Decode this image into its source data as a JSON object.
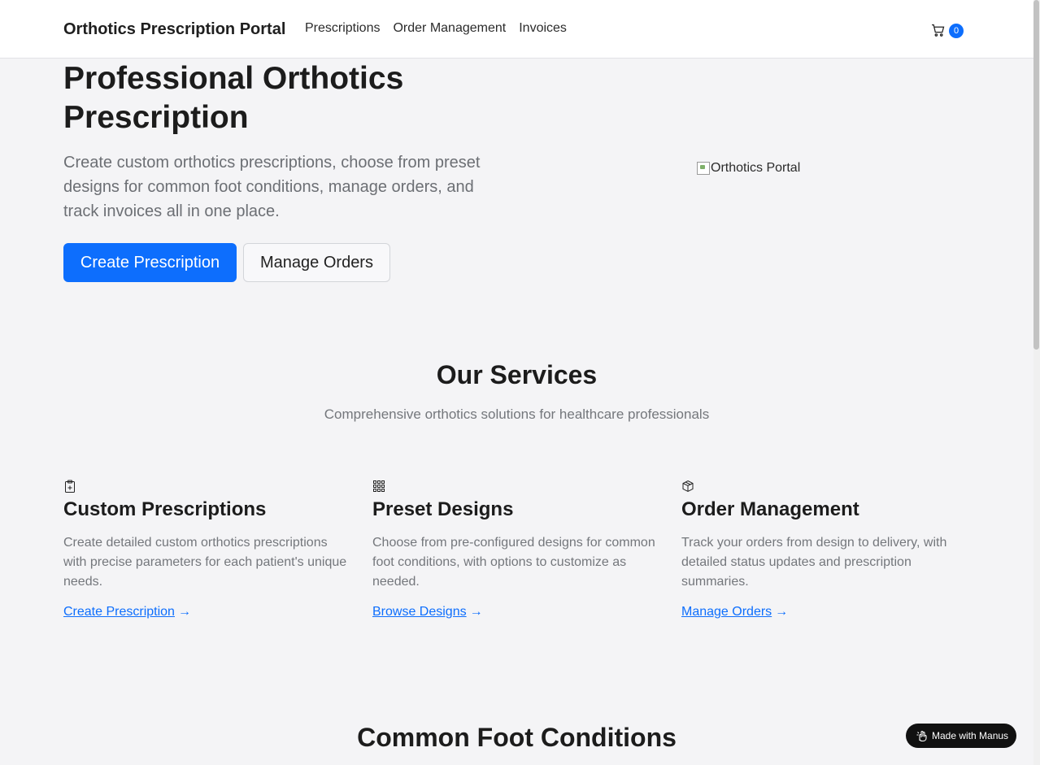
{
  "navbar": {
    "brand": "Orthotics Prescription Portal",
    "links": [
      "Prescriptions",
      "Order Management",
      "Invoices"
    ],
    "cart_count": "0"
  },
  "hero": {
    "title": "Professional Orthotics Prescription",
    "lead": "Create custom orthotics prescriptions, choose from preset designs for common foot conditions, manage orders, and track invoices all in one place.",
    "primary_button": "Create Prescription",
    "secondary_button": "Manage Orders",
    "image_alt": "Orthotics Portal"
  },
  "services": {
    "title": "Our Services",
    "subtitle": "Comprehensive orthotics solutions for healthcare professionals",
    "cards": [
      {
        "icon": "clipboard-plus-icon",
        "title": "Custom Prescriptions",
        "text": "Create detailed custom orthotics prescriptions with precise parameters for each patient's unique needs.",
        "link": "Create Prescription"
      },
      {
        "icon": "grid-icon",
        "title": "Preset Designs",
        "text": "Choose from pre-configured designs for common foot conditions, with options to customize as needed.",
        "link": "Browse Designs"
      },
      {
        "icon": "box-icon",
        "title": "Order Management",
        "text": "Track your orders from design to delivery, with detailed status updates and prescription summaries.",
        "link": "Manage Orders"
      }
    ]
  },
  "conditions": {
    "title": "Common Foot Conditions"
  },
  "badge": {
    "label": "Made with Manus"
  },
  "colors": {
    "accent": "#0d6efd",
    "background": "#f4f4f6",
    "muted_text": "#74777c"
  }
}
